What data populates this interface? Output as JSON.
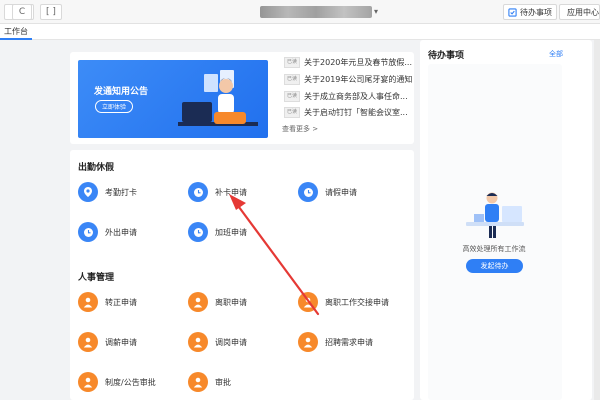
{
  "toolbar": {
    "left_buttons": [
      "<",
      "C",
      "[ ]"
    ],
    "todo_button": "待办事项",
    "apps_button": "应用中心"
  },
  "tabs": [
    {
      "label": "工作台"
    }
  ],
  "banner": {
    "title": "发通知用公告",
    "button": "立即体验"
  },
  "notices": {
    "items": [
      {
        "tag": "已读",
        "text": "关于2020年元旦及春节放假..."
      },
      {
        "tag": "已读",
        "text": "关于2019年公司尾牙宴的通知"
      },
      {
        "tag": "已读",
        "text": "关于成立商务部及人事任命..."
      },
      {
        "tag": "已读",
        "text": "关于启动钉钉「智能会议室..."
      }
    ],
    "more": "查看更多 >"
  },
  "attendance": {
    "title": "出勤休假",
    "items": [
      "考勤打卡",
      "补卡申请",
      "请假申请",
      "外出申请",
      "加班申请"
    ]
  },
  "hr": {
    "title": "人事管理",
    "items": [
      "转正申请",
      "离职申请",
      "离职工作交接申请",
      "调薪申请",
      "调岗申请",
      "招聘需求申请",
      "制度/公告审批",
      "审批"
    ]
  },
  "todo_panel": {
    "title": "待办事项",
    "all": "全部",
    "empty_message": "高效处理所有工作流",
    "start_button": "发起待办"
  },
  "colors": {
    "accent": "#2f7ff5",
    "attendance_icon": "#3a86f6",
    "hr_icon": "#f7892b",
    "arrow": "#e53935"
  }
}
